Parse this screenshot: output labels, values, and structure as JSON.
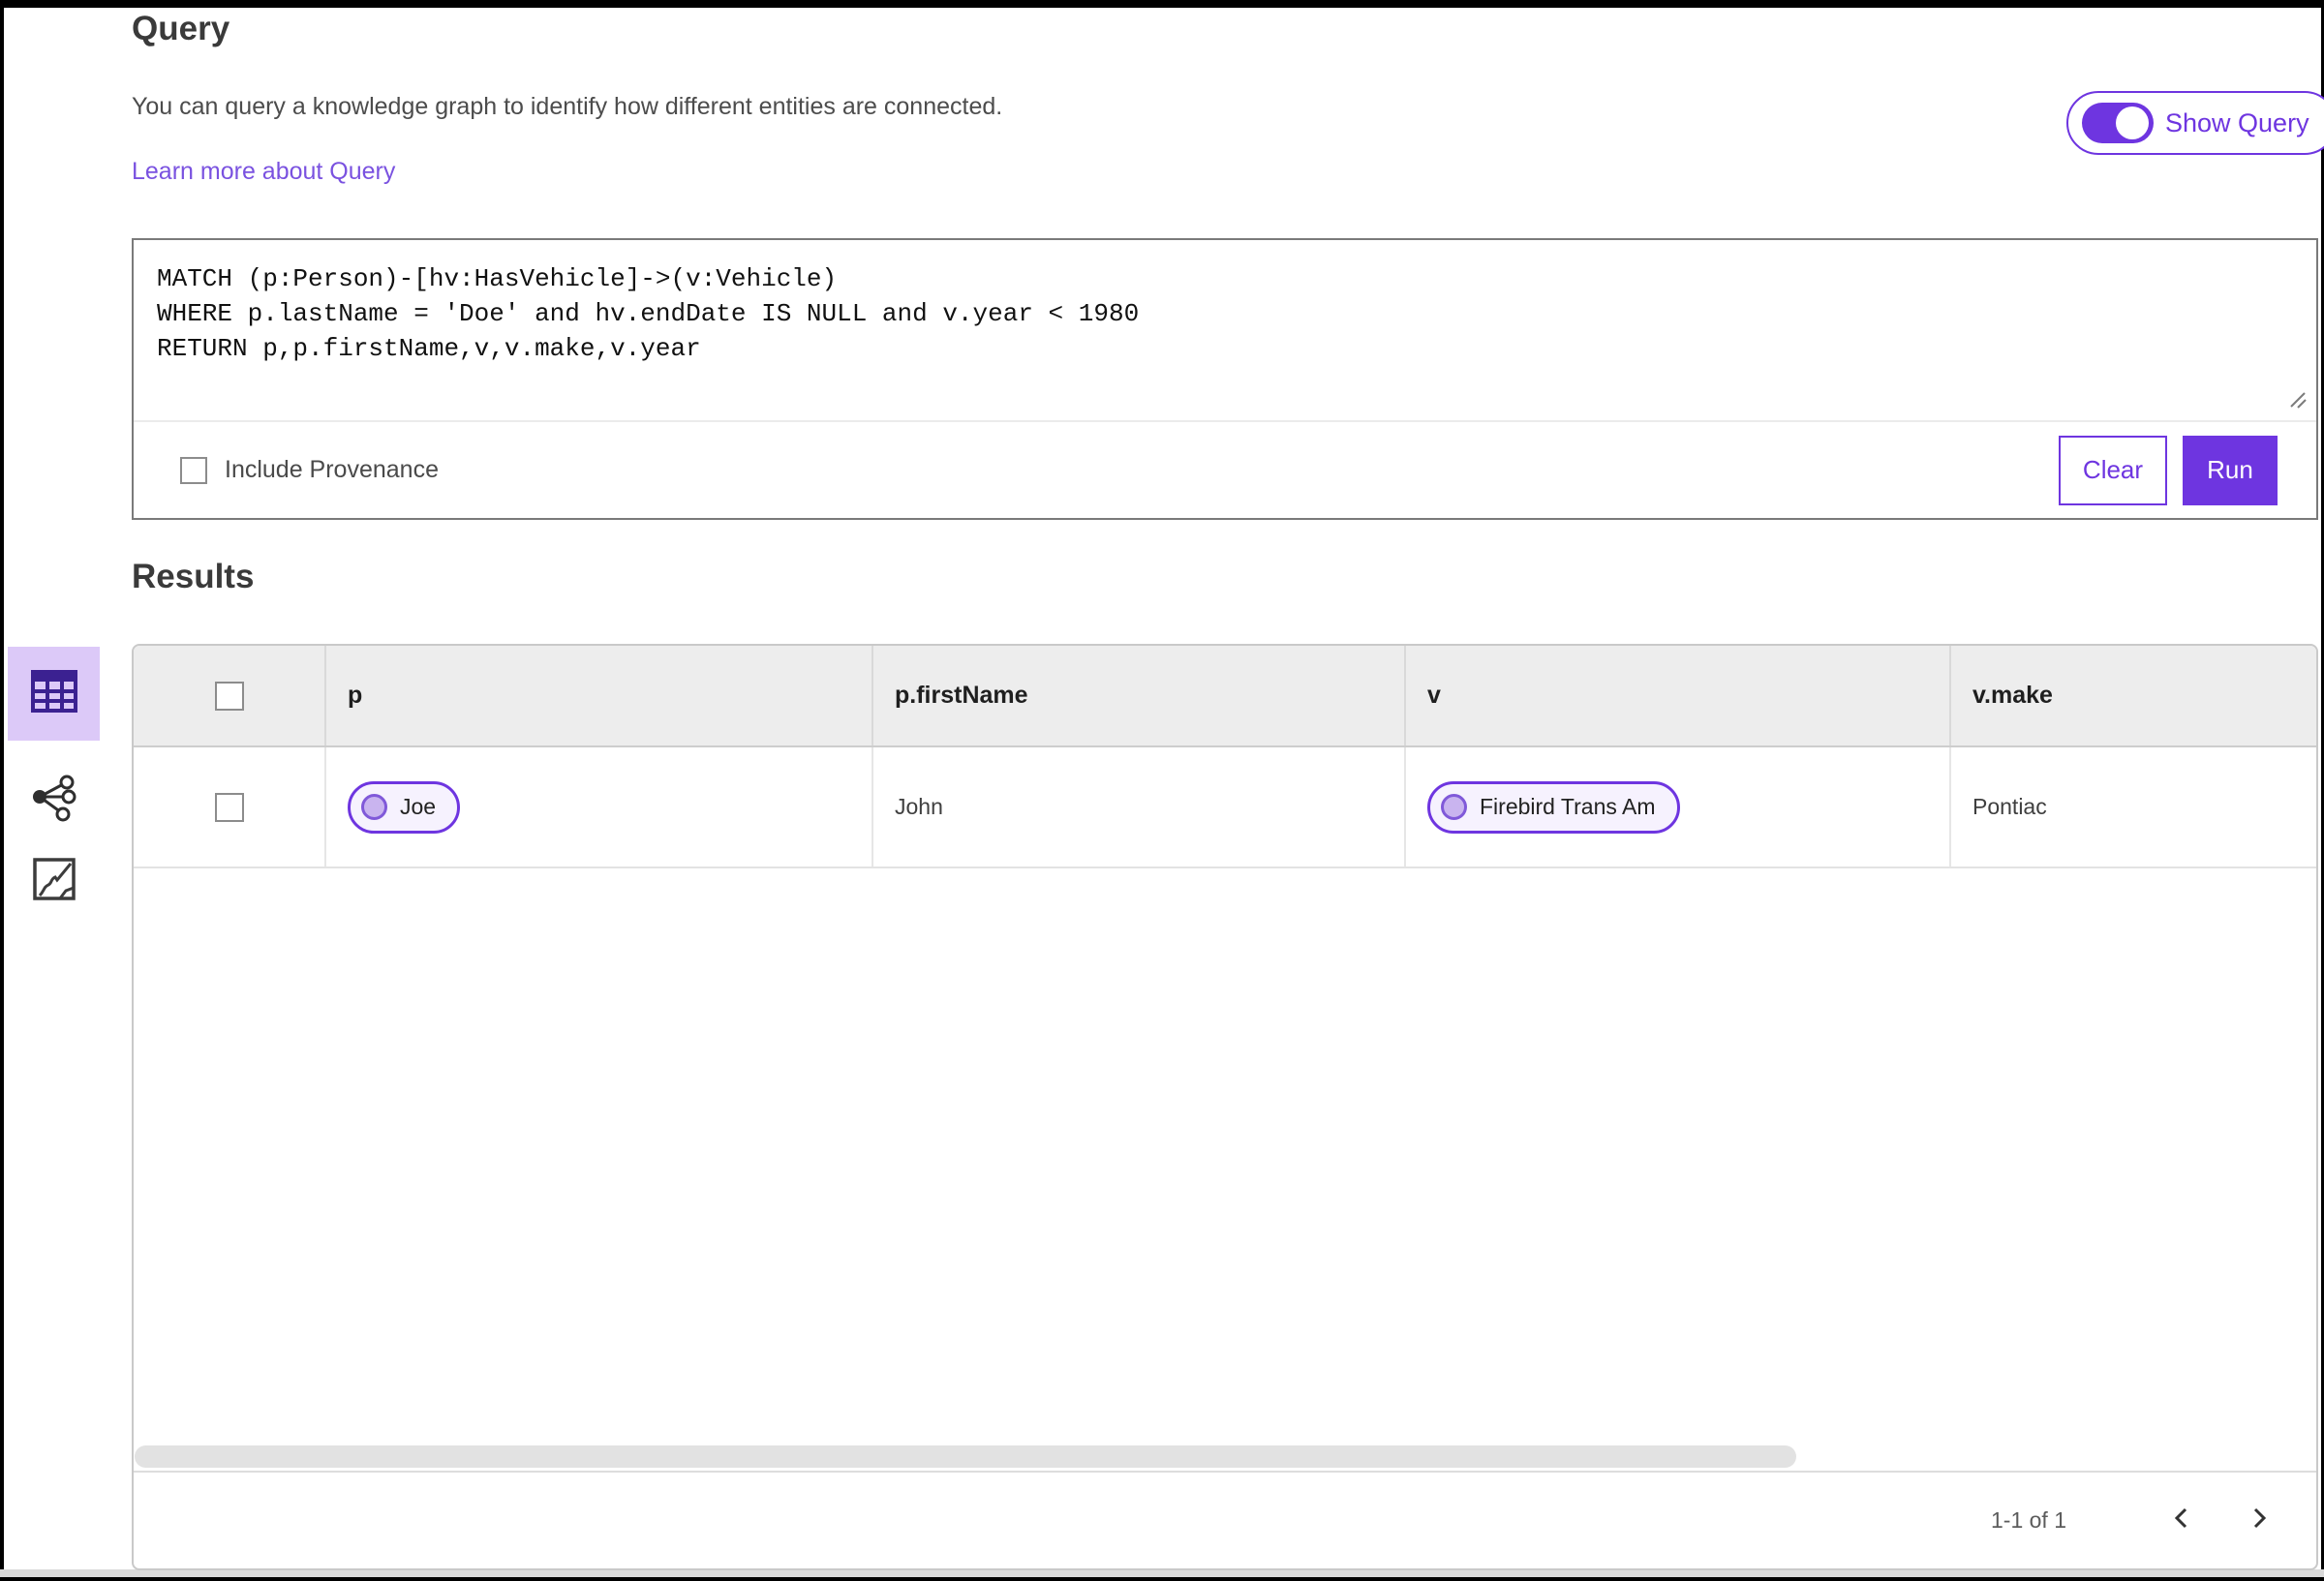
{
  "header": {
    "title": "Query",
    "description": "You can query a knowledge graph to identify how different entities are connected.",
    "learn_more_link": "Learn more about Query",
    "show_query": {
      "label": "Show Query",
      "state": "on"
    }
  },
  "query_editor": {
    "query_text": "MATCH (p:Person)-[hv:HasVehicle]->(v:Vehicle)\nWHERE p.lastName = 'Doe' and hv.endDate IS NULL and v.year < 1980\nRETURN p,p.firstName,v,v.make,v.year",
    "include_provenance": {
      "label": "Include Provenance",
      "checked": false
    },
    "buttons": {
      "clear": "Clear",
      "run": "Run"
    }
  },
  "results": {
    "heading": "Results",
    "views": [
      {
        "name": "table-view",
        "selected": true
      },
      {
        "name": "graph-view",
        "selected": false
      },
      {
        "name": "map-view",
        "selected": false
      }
    ],
    "table": {
      "columns": [
        "p",
        "p.firstName",
        "v",
        "v.make"
      ],
      "rows": [
        {
          "p": "Joe",
          "p_firstName": "John",
          "v": "Firebird Trans Am",
          "v_make": "Pontiac"
        }
      ]
    },
    "pagination": {
      "range": "1-1 of 1"
    }
  },
  "colors": {
    "accent_purple": "#6e35e0",
    "link_purple": "#7a52e0",
    "selected_view_bg": "#dcc9f8",
    "chip_bg": "#f6f2fe",
    "chip_dot_fill": "#c9b4ef",
    "chip_dot_border": "#8059d9",
    "table_header_bg": "#ededed"
  }
}
